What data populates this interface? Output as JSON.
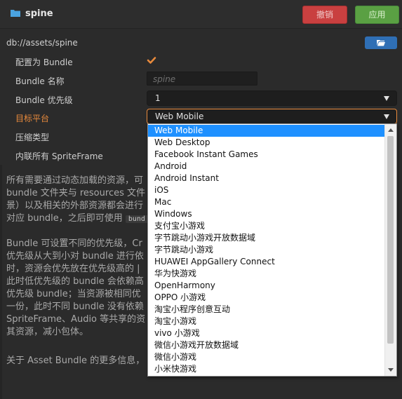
{
  "header": {
    "title": "spine",
    "revert_label": "撤销",
    "apply_label": "应用"
  },
  "path": "db://assets/spine",
  "form": {
    "bundle_config_label": "配置为 Bundle",
    "bundle_config_checked": true,
    "bundle_name_label": "Bundle 名称",
    "bundle_name_placeholder": "spine",
    "bundle_priority_label": "Bundle 优先级",
    "bundle_priority_value": "1",
    "target_platform_label": "目标平台",
    "target_platform_value": "Web Mobile",
    "compression_label": "压缩类型",
    "inline_spriteframe_label": "内联所有 SpriteFrame"
  },
  "description": {
    "para1": [
      "所有需要通过动态加载的资源，可",
      "bundle 文件夹与 resources 文件",
      "景）以及相关的外部资源都会进行",
      "对应 bundle，之后即可使用"
    ],
    "para1_code": "bund",
    "para2": [
      "Bundle 可设置不同的优先级，Cr",
      "优先级从大到小对 bundle 进行依",
      "时，资源会优先放在优先级高的 |",
      "此时低优先级的 bundle 会依赖高",
      "优先级 bundle；当资源被相同优",
      "一份，此时不同 bundle 没有依赖",
      "SpriteFrame、Audio 等共享的资",
      "其资源，减小包体。"
    ],
    "para3": "关于 Asset Bundle 的更多信息，"
  },
  "dropdown": {
    "selected_index": 0,
    "options": [
      "Web Mobile",
      "Web Desktop",
      "Facebook Instant Games",
      "Android",
      "Android Instant",
      "iOS",
      "Mac",
      "Windows",
      "支付宝小游戏",
      "字节跳动小游戏开放数据域",
      "字节跳动小游戏",
      "HUAWEI AppGallery Connect",
      "华为快游戏",
      "OpenHarmony",
      "OPPO 小游戏",
      "淘宝小程序创意互动",
      "淘宝小游戏",
      "vivo 小游戏",
      "微信小游戏开放数据域",
      "微信小游戏",
      "小米快游戏"
    ]
  },
  "colors": {
    "background": "#2b2b2b",
    "accent": "#e88a3c",
    "selection": "#1e90ff",
    "revert": "#c94040",
    "apply": "#5aa043",
    "primary_button": "#2f6fb5"
  }
}
